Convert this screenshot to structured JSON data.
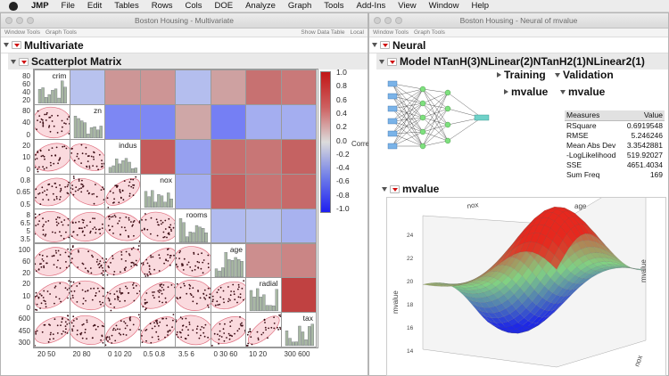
{
  "menubar": {
    "app": "JMP",
    "items": [
      "File",
      "Edit",
      "Tables",
      "Rows",
      "Cols",
      "DOE",
      "Analyze",
      "Graph",
      "Tools",
      "Add-Ins",
      "View",
      "Window",
      "Help"
    ]
  },
  "left_window": {
    "title": "Boston Housing - Multivariate",
    "toolbar_left": [
      "Window Tools",
      "Graph Tools"
    ],
    "toolbar_right": [
      "Show Data Table",
      "Local"
    ],
    "section": "Multivariate",
    "subsection": "Scatterplot Matrix",
    "variables": [
      "crim",
      "zn",
      "indus",
      "nox",
      "rooms",
      "age",
      "radial",
      "tax"
    ],
    "y_ticks": [
      [
        "80",
        "60",
        "40",
        "20"
      ],
      [
        "80",
        "40",
        "0"
      ],
      [
        "20",
        "10",
        "0"
      ],
      [
        "0.8",
        "0.65",
        "0.5"
      ],
      [
        "8",
        "6.5",
        "5",
        "3.5"
      ],
      [
        "100",
        "60",
        "20"
      ],
      [
        "20",
        "10",
        "0"
      ],
      [
        "600",
        "450",
        "300"
      ]
    ],
    "x_ticks": [
      "20 50",
      "20 80",
      "0 10 20",
      "0.5 0.8",
      "3.5 6",
      "0 30 60",
      "10 20",
      "300 600"
    ],
    "colorbar_ticks": [
      "1.0",
      "0.8",
      "0.6",
      "0.4",
      "0.2",
      "0.0",
      "-0.2",
      "-0.4",
      "-0.6",
      "-0.8",
      "-1.0"
    ],
    "colorbar_label": "Corre",
    "correlations": [
      [
        1,
        -0.2,
        0.41,
        0.42,
        -0.22,
        0.35,
        0.63,
        0.58
      ],
      [
        -0.2,
        1,
        -0.53,
        -0.52,
        0.31,
        -0.57,
        -0.31,
        -0.31
      ],
      [
        0.41,
        -0.53,
        1,
        0.76,
        -0.39,
        0.64,
        0.6,
        0.72
      ],
      [
        0.42,
        -0.52,
        0.76,
        1,
        -0.3,
        0.73,
        0.61,
        0.67
      ],
      [
        -0.22,
        0.31,
        -0.39,
        -0.3,
        1,
        -0.24,
        -0.21,
        -0.29
      ],
      [
        0.35,
        -0.57,
        0.64,
        0.73,
        -0.24,
        1,
        0.46,
        0.51
      ],
      [
        0.63,
        -0.31,
        0.6,
        0.61,
        -0.21,
        0.46,
        1,
        0.91
      ],
      [
        0.58,
        -0.31,
        0.72,
        0.67,
        -0.29,
        0.51,
        0.91,
        1
      ]
    ]
  },
  "right_window": {
    "title": "Boston Housing - Neural of mvalue",
    "toolbar_left": [
      "Window Tools",
      "Graph Tools"
    ],
    "section": "Neural",
    "model": "Model NTanH(3)NLinear(2)NTanH2(1)NLinear2(1)",
    "training": "Training",
    "training_sub": "mvalue",
    "validation": "Validation",
    "validation_sub": "mvalue",
    "table": {
      "headers": [
        "Measures",
        "Value"
      ],
      "rows": [
        [
          "RSquare",
          "0.6919548"
        ],
        [
          "RMSE",
          "5.246246"
        ],
        [
          "Mean Abs Dev",
          "3.3542881"
        ],
        [
          "-LogLikelihood",
          "519.92027"
        ],
        [
          "SSE",
          "4651.4034"
        ],
        [
          "Sum Freq",
          "169"
        ]
      ]
    },
    "surface_title": "mvalue",
    "surface_axes": {
      "top_left": "nox",
      "top_right": "age",
      "left": "mvalue",
      "right": "mvalue",
      "bottom_right": "nox"
    },
    "surface_ticks": [
      "24",
      "22",
      "20",
      "18",
      "16",
      "14"
    ]
  }
}
